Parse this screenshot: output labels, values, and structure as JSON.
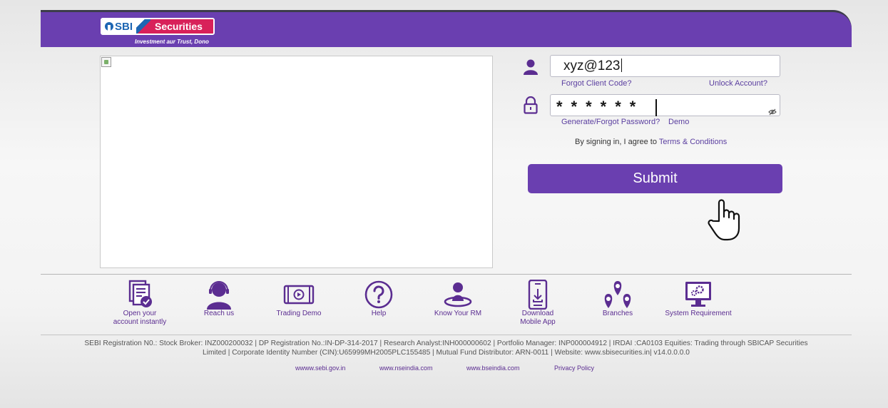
{
  "header": {
    "logo_sbi": "SBI",
    "logo_securities": "Securities",
    "tagline": "Investment aur Trust, Dono",
    "brand_color": "#6a3fb0"
  },
  "login": {
    "client_code_value": "xyz@123",
    "forgot_client_code": "Forgot Client Code?",
    "unlock_account": "Unlock Account?",
    "password_value": "******",
    "generate_forgot_password": "Generate/Forgot Password?",
    "demo": "Demo",
    "agree_prefix": "By signing in, I agree to",
    "terms": "Terms & Conditions",
    "submit": "Submit"
  },
  "quick_links": [
    {
      "label_line1": "Open your",
      "label_line2": "account instantly",
      "icon": "open-account-icon"
    },
    {
      "label_line1": "Reach us",
      "label_line2": "",
      "icon": "headset-icon"
    },
    {
      "label_line1": "Trading Demo",
      "label_line2": "",
      "icon": "video-play-icon"
    },
    {
      "label_line1": "Help",
      "label_line2": "",
      "icon": "help-icon"
    },
    {
      "label_line1": "Know Your RM",
      "label_line2": "",
      "icon": "person-icon"
    },
    {
      "label_line1": "Download",
      "label_line2": "Mobile App",
      "icon": "mobile-download-icon"
    },
    {
      "label_line1": "Branches",
      "label_line2": "",
      "icon": "map-pin-icon"
    },
    {
      "label_line1": "System Requirement",
      "label_line2": "",
      "icon": "monitor-gear-icon"
    }
  ],
  "footer": {
    "line1": "SEBI Registration N0.: Stock Broker: INZ000200032 | DP Registration No.:IN-DP-314-2017 | Research Analyst:INH000000602 | Portfolio Manager: INP000004912 | IRDAI :CA0103 Equities: Trading through SBICAP Securities",
    "line2": "Limited | Corporate Identity Number (CIN):U65999MH2005PLC155485 | Mutual Fund Distributor: ARN-0011 | Website: www.sbisecurities.in| v14.0.0.0.0",
    "links": [
      "wwww.sebi.gov.in",
      "www.nseindia.com",
      "www.bseindia.com",
      "Privacy Policy"
    ]
  }
}
